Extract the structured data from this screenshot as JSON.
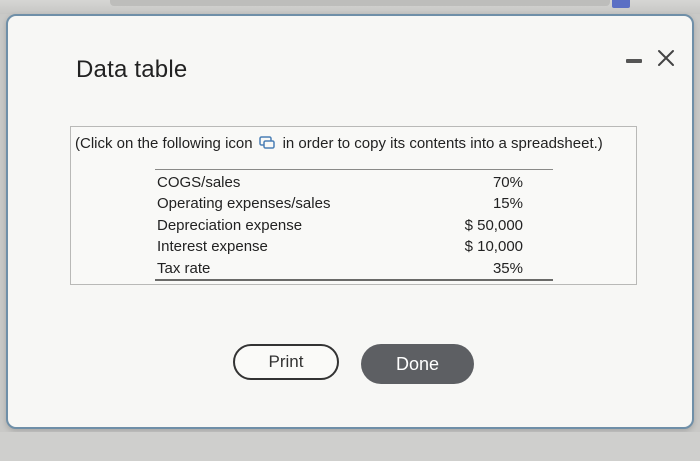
{
  "modal": {
    "title": "Data table",
    "minimize_icon": "minimize-icon",
    "close_icon": "close-icon"
  },
  "instruction": {
    "prefix": "(Click on the following icon",
    "icon": "copy-icon",
    "suffix": "in order to copy its contents into a spreadsheet.)"
  },
  "table": {
    "rows": [
      {
        "label": "COGS/sales",
        "value": "70%"
      },
      {
        "label": "Operating expenses/sales",
        "value": "15%"
      },
      {
        "label": "Depreciation expense",
        "value": "$ 50,000"
      },
      {
        "label": "Interest expense",
        "value": "$ 10,000"
      },
      {
        "label": "Tax rate",
        "value": "35%"
      }
    ]
  },
  "buttons": {
    "print_label": "Print",
    "done_label": "Done"
  },
  "colors": {
    "modal_border": "#6f8fa8",
    "done_button": "#5d5f63",
    "copy_icon": "#4a7fb5"
  }
}
